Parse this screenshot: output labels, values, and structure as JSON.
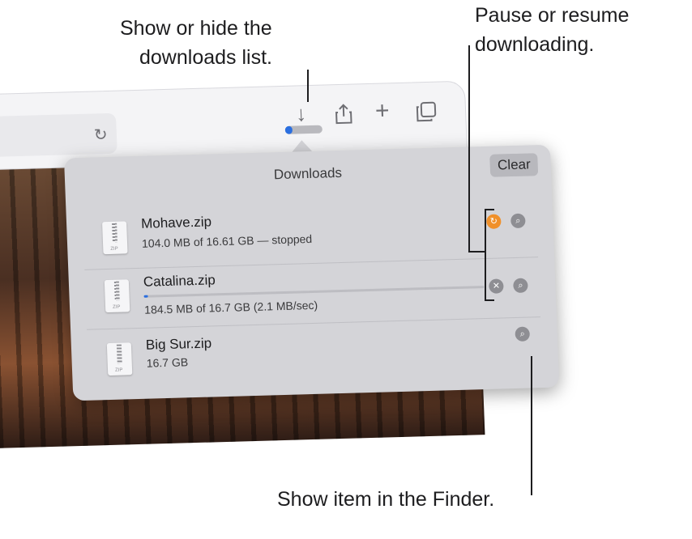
{
  "toolbar": {
    "reload_icon": "reload-icon",
    "download_icon": "download-arrow-icon",
    "share_icon": "share-icon",
    "new_tab_icon": "plus-icon",
    "tabs_icon": "tab-overview-icon",
    "download_progress_fraction": 0.2,
    "accent_color": "#2b6fe0"
  },
  "downloads": {
    "title": "Downloads",
    "clear_label": "Clear",
    "items": [
      {
        "name": "Mohave.zip",
        "status": "104.0 MB of 16.61 GB — stopped",
        "action": "resume",
        "action_color": "#f0902a",
        "file_icon_tag": "ZIP"
      },
      {
        "name": "Catalina.zip",
        "status": "184.5 MB of 16.7 GB (2.1 MB/sec)",
        "action": "stop",
        "progress_fraction": 0.011,
        "file_icon_tag": "ZIP"
      },
      {
        "name": "Big Sur.zip",
        "status": "16.7 GB",
        "action": "show-in-finder",
        "file_icon_tag": "ZIP"
      }
    ]
  },
  "callouts": {
    "show_hide_line1": "Show or hide the",
    "show_hide_line2": "downloads list.",
    "pause_line1": "Pause or resume",
    "pause_line2": "downloading.",
    "finder": "Show item in the Finder."
  }
}
